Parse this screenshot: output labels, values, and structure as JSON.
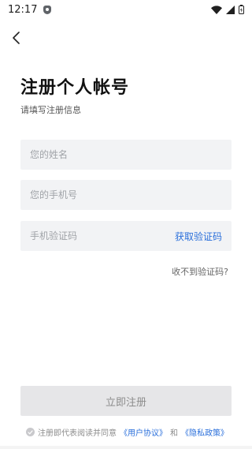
{
  "status_bar": {
    "time": "12:17",
    "icons": [
      "shield-icon",
      "wifi-icon",
      "signal-icon",
      "battery-icon"
    ]
  },
  "header": {
    "back_icon": "chevron-left-icon",
    "title": "注册个人帐号",
    "subtitle": "请填写注册信息"
  },
  "form": {
    "name_placeholder": "您的姓名",
    "phone_placeholder": "您的手机号",
    "code_placeholder": "手机验证码",
    "get_code_label": "获取验证码",
    "no_code_label": "收不到验证码?"
  },
  "actions": {
    "register_label": "立即注册"
  },
  "agreement": {
    "prefix": "注册即代表阅读并同意",
    "user_agreement": "《用户协议》",
    "conjunction": "和",
    "privacy_policy": "《隐私政策》"
  },
  "colors": {
    "accent": "#2a6fdb",
    "field_bg": "#f2f3f5",
    "button_disabled_bg": "#e6e6e8"
  }
}
